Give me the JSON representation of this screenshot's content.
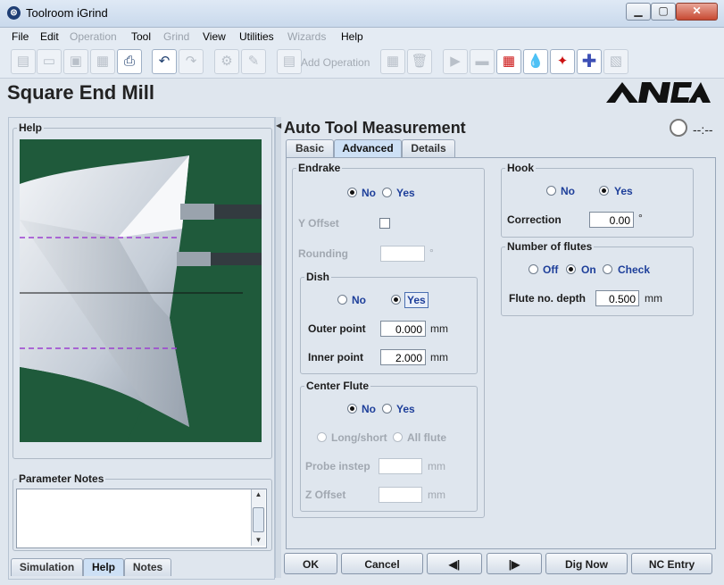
{
  "window": {
    "title": "Toolroom iGrind"
  },
  "menu": [
    {
      "label": "File",
      "enabled": true
    },
    {
      "label": "Edit",
      "enabled": true
    },
    {
      "label": "Operation",
      "enabled": false
    },
    {
      "label": "Tool",
      "enabled": true
    },
    {
      "label": "Grind",
      "enabled": false
    },
    {
      "label": "View",
      "enabled": true
    },
    {
      "label": "Utilities",
      "enabled": true
    },
    {
      "label": "Wizards",
      "enabled": false
    },
    {
      "label": "Help",
      "enabled": true
    }
  ],
  "toolbar": {
    "add_operation": "Add Operation"
  },
  "header": {
    "title": "Square End Mill",
    "logo": "ANCA"
  },
  "left": {
    "help_legend": "Help",
    "notes_legend": "Parameter Notes",
    "tabs": [
      "Simulation",
      "Help",
      "Notes"
    ]
  },
  "right": {
    "title": "Auto Tool Measurement",
    "timer": "--:--",
    "tabs": [
      "Basic",
      "Advanced",
      "Details"
    ],
    "endrake": {
      "legend": "Endrake",
      "no": "No",
      "yes": "Yes",
      "y_offset": "Y Offset",
      "rounding": "Rounding",
      "rounding_unit": "°",
      "dish": {
        "legend": "Dish",
        "no": "No",
        "yes": "Yes",
        "outer_label": "Outer point",
        "outer_value": "0.000",
        "inner_label": "Inner point",
        "inner_value": "2.000",
        "unit": "mm"
      },
      "center_flute": {
        "legend": "Center Flute",
        "no": "No",
        "yes": "Yes",
        "long_short": "Long/short",
        "all_flute": "All flute",
        "probe_instep": "Probe instep",
        "z_offset": "Z Offset",
        "unit": "mm"
      }
    },
    "hook": {
      "legend": "Hook",
      "no": "No",
      "yes": "Yes",
      "correction_label": "Correction",
      "correction_value": "0.00",
      "unit": "°"
    },
    "flutes": {
      "legend": "Number of flutes",
      "off": "Off",
      "on": "On",
      "check": "Check",
      "depth_label": "Flute no. depth",
      "depth_value": "0.500",
      "unit": "mm"
    }
  },
  "buttons": {
    "ok": "OK",
    "cancel": "Cancel",
    "prev": "◀|",
    "next": "|▶",
    "dig_now": "Dig Now",
    "nc_entry": "NC Entry"
  },
  "colors": {
    "radio_text": "#1e3f9a",
    "help_bg": "#1f5a3b",
    "guide_line": "#9b3fd0"
  }
}
